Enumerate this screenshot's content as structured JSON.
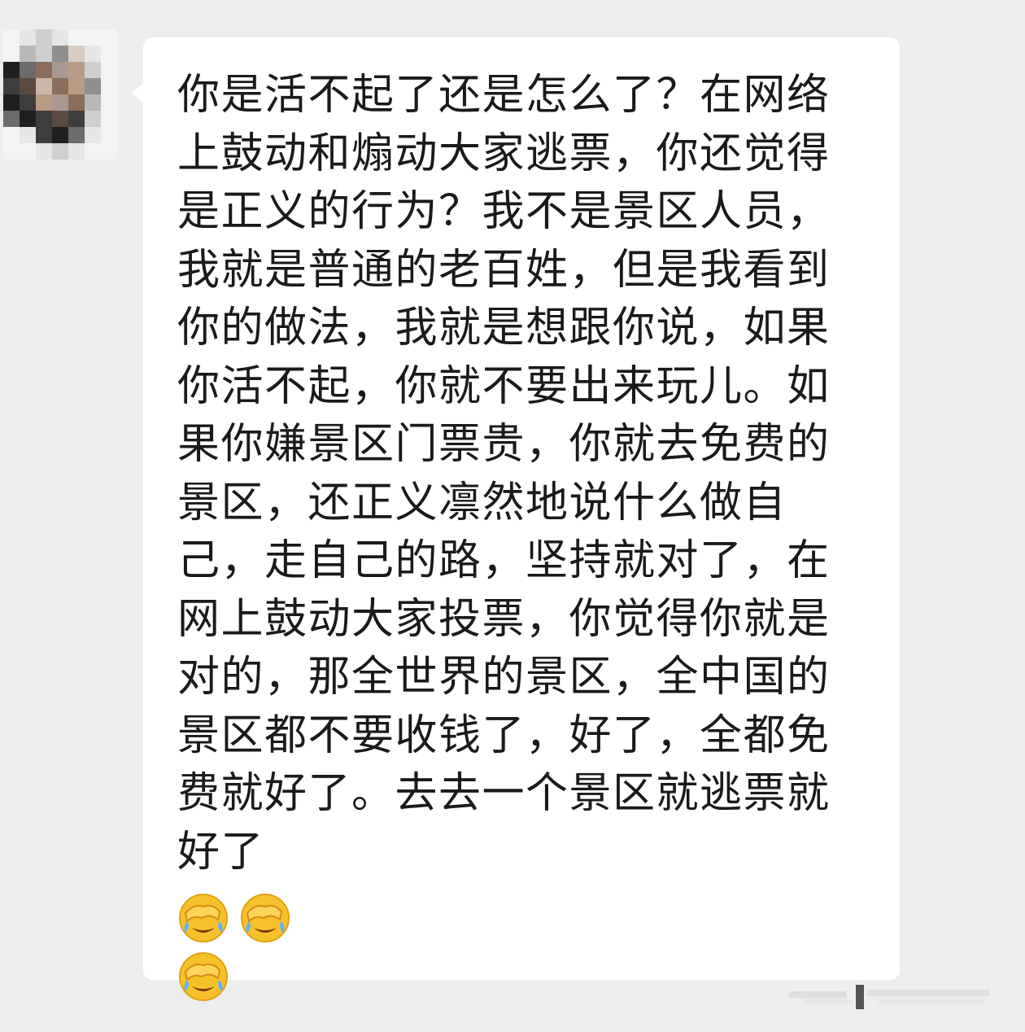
{
  "chat": {
    "message": {
      "text": "你是活不起了还是怎么了？在网络上鼓动和煽动大家逃票，你还觉得是正义的行为？我不是景区人员，我就是普通的老百姓，但是我看到你的做法，我就是想跟你说，如果你活不起，你就不要出来玩儿。如果你嫌景区门票贵，你就去免费的景区，还正义凛然地说什么做自己，走自己的路，坚持就对了，在网上鼓动大家投票，你觉得你就是对的，那全世界的景区，全中国的景区都不要收钱了，好了，全都免费就好了。去去一个景区就逃票就好了",
      "emojis": [
        "facepalm-crying-emoji",
        "facepalm-crying-emoji",
        "facepalm-crying-emoji"
      ]
    },
    "colors": {
      "background": "#ededed",
      "bubble": "#ffffff",
      "text": "#1a1a1a",
      "emoji_face": "#f7c12b"
    }
  }
}
